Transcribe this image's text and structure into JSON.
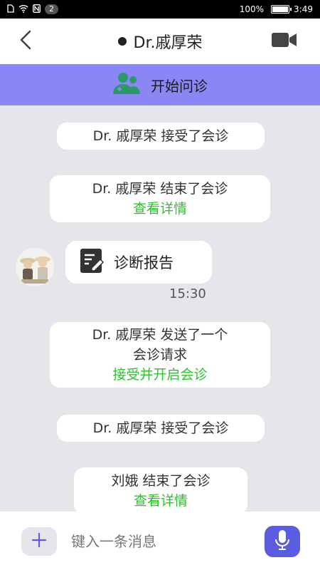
{
  "status_bar": {
    "left_icons": [
      "doc-icon",
      "wifi-icon",
      "nfc-icon"
    ],
    "notification_count": "2",
    "battery_percent": "100%",
    "time": "3:49"
  },
  "header": {
    "title": "Dr.戚厚荣"
  },
  "banner": {
    "label": "开始问诊",
    "color": "#8a87f5"
  },
  "messages": {
    "m1": {
      "text": "Dr. 戚厚荣 接受了会诊"
    },
    "m2": {
      "text": "Dr. 戚厚荣  结束了会诊",
      "link": "查看详情"
    },
    "m3": {
      "label": "诊断报告",
      "time": "15:30"
    },
    "m4": {
      "line1": "Dr. 戚厚荣 发送了一个",
      "line2": "会诊请求",
      "link": "接受并开启会诊"
    },
    "m5": {
      "text": "Dr. 戚厚荣 接受了会诊"
    },
    "m6": {
      "text": "刘娥  结束了会诊",
      "link": "查看详情"
    }
  },
  "input": {
    "placeholder": "键入一条消息",
    "value": ""
  },
  "colors": {
    "accent": "#5b5ce0",
    "link": "#2ec22e",
    "chat_bg": "#e6e5ea"
  }
}
